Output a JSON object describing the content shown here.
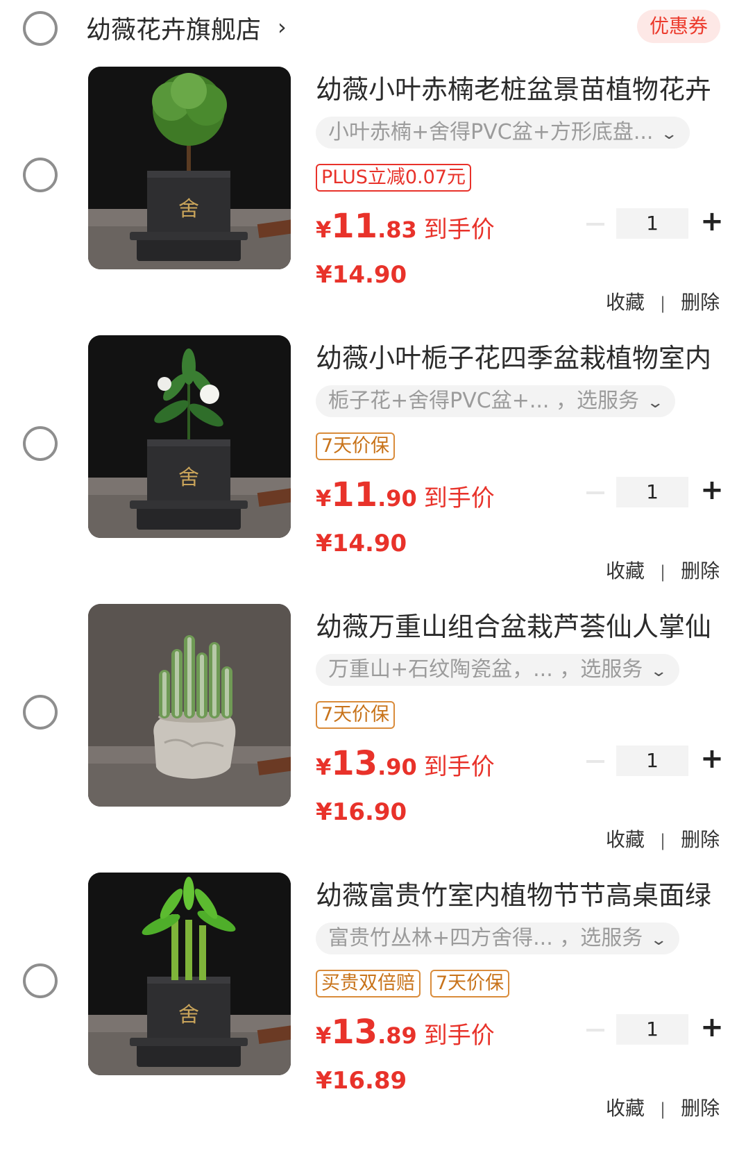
{
  "store": {
    "name": "幼薇花卉旗舰店",
    "chevron": "›",
    "coupon_label": "优惠券"
  },
  "items": [
    {
      "title": "幼薇小叶赤楠老桩盆景苗植物花卉",
      "sku": "小叶赤楠+舍得PVC盆+方形底盘...",
      "sku_chevron": "⌄",
      "tags": [
        {
          "text": "PLUS立减0.07元",
          "style": "red"
        }
      ],
      "price_yen": "¥",
      "price_int": "11",
      "price_dec": ".83",
      "price_label": "到手价",
      "original_price": "¥14.90",
      "quantity": "1",
      "plus": "+",
      "favorite": "收藏",
      "separator": "|",
      "delete": "删除",
      "thumb": {
        "plant": "tree",
        "pot": "square-dark"
      }
    },
    {
      "title": "幼薇小叶栀子花四季盆栽植物室内",
      "sku": "栀子花+舍得PVC盆+...    ，选服务",
      "sku_chevron": "⌄",
      "tags": [
        {
          "text": "7天价保",
          "style": "orange"
        }
      ],
      "price_yen": "¥",
      "price_int": "11",
      "price_dec": ".90",
      "price_label": "到手价",
      "original_price": "¥14.90",
      "quantity": "1",
      "plus": "+",
      "favorite": "收藏",
      "separator": "|",
      "delete": "删除",
      "thumb": {
        "plant": "gardenia",
        "pot": "square-dark"
      }
    },
    {
      "title": "幼薇万重山组合盆栽芦荟仙人掌仙",
      "sku": "万重山+石纹陶瓷盆，...   ，选服务",
      "sku_chevron": "⌄",
      "tags": [
        {
          "text": "7天价保",
          "style": "orange"
        }
      ],
      "price_yen": "¥",
      "price_int": "13",
      "price_dec": ".90",
      "price_label": "到手价",
      "original_price": "¥16.90",
      "quantity": "1",
      "plus": "+",
      "favorite": "收藏",
      "separator": "|",
      "delete": "删除",
      "thumb": {
        "plant": "cactus",
        "pot": "stone"
      }
    },
    {
      "title": "幼薇富贵竹室内植物节节高桌面绿",
      "sku": "富贵竹丛林+四方舍得...   ，选服务",
      "sku_chevron": "⌄",
      "tags": [
        {
          "text": "买贵双倍赔",
          "style": "orange"
        },
        {
          "text": "7天价保",
          "style": "orange"
        }
      ],
      "price_yen": "¥",
      "price_int": "13",
      "price_dec": ".89",
      "price_label": "到手价",
      "original_price": "¥16.89",
      "quantity": "1",
      "plus": "+",
      "favorite": "收藏",
      "separator": "|",
      "delete": "删除",
      "thumb": {
        "plant": "bamboo",
        "pot": "square-dark"
      }
    }
  ]
}
